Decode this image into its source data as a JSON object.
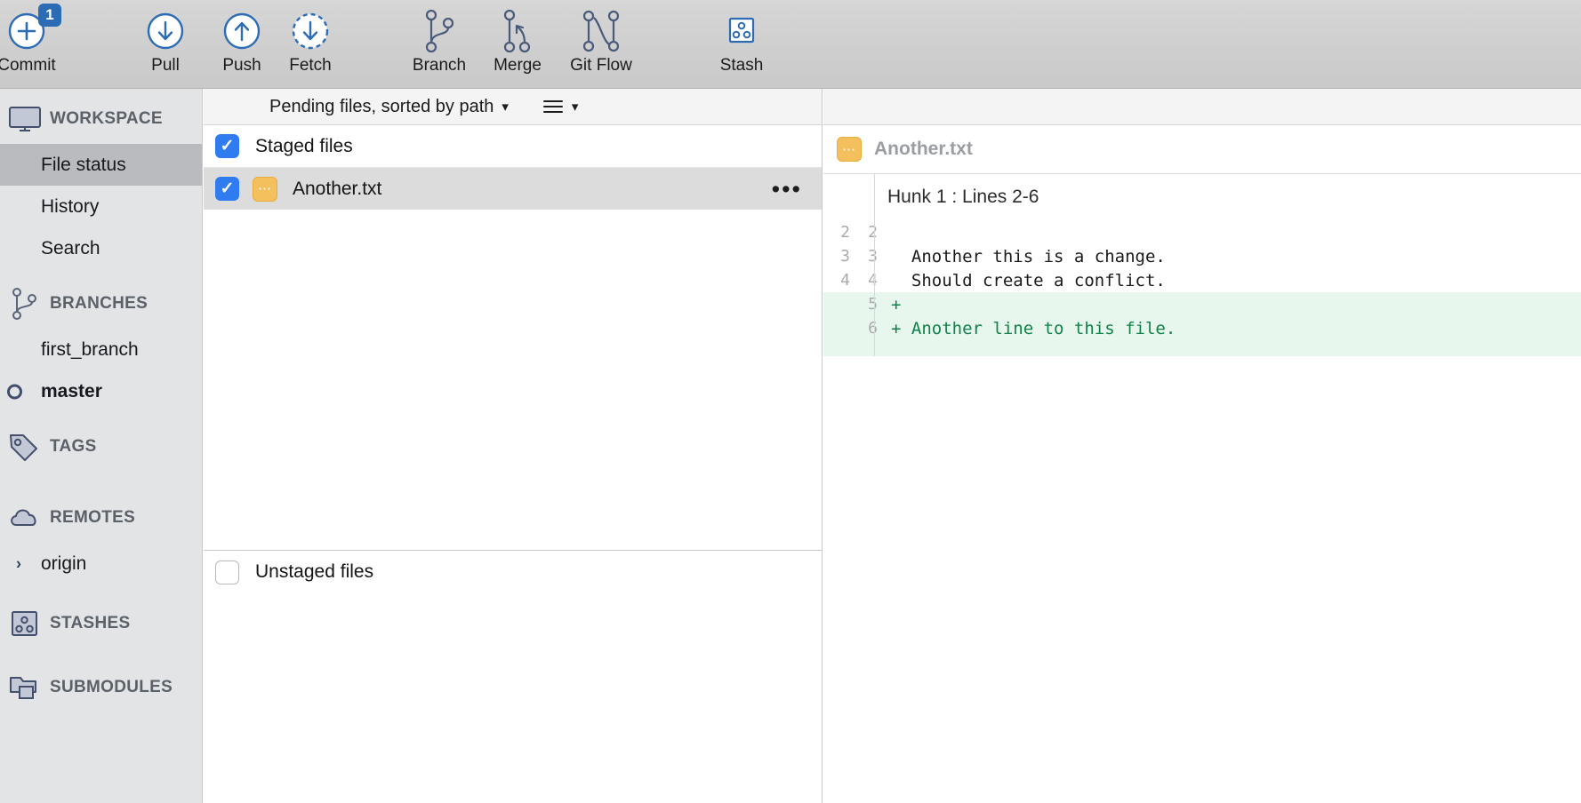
{
  "toolbar": {
    "items": [
      {
        "label": "Commit",
        "icon": "commit-plus-circle-icon",
        "badge": "1"
      },
      {
        "label": "Pull",
        "icon": "arrow-down-circle-icon",
        "badge": ""
      },
      {
        "label": "Push",
        "icon": "arrow-up-circle-icon",
        "badge": ""
      },
      {
        "label": "Fetch",
        "icon": "arrow-down-dashed-circle-icon",
        "badge": ""
      },
      {
        "label": "Branch",
        "icon": "branch-icon",
        "badge": ""
      },
      {
        "label": "Merge",
        "icon": "merge-icon",
        "badge": ""
      },
      {
        "label": "Git Flow",
        "icon": "git-flow-icon",
        "badge": ""
      },
      {
        "label": "Stash",
        "icon": "stash-icon",
        "badge": ""
      }
    ],
    "accent_color": "#2b6cb5",
    "badge_bg": "#2b6cb5"
  },
  "sidebar": {
    "sections": [
      {
        "title": "WORKSPACE",
        "icon": "monitor-icon"
      },
      {
        "title": "BRANCHES",
        "icon": "branch-icon"
      },
      {
        "title": "TAGS",
        "icon": "tag-icon"
      },
      {
        "title": "REMOTES",
        "icon": "cloud-icon"
      },
      {
        "title": "STASHES",
        "icon": "stash-icon"
      },
      {
        "title": "SUBMODULES",
        "icon": "submodule-icon"
      }
    ],
    "workspace_items": [
      {
        "label": "File status",
        "selected": true
      },
      {
        "label": "History",
        "selected": false
      },
      {
        "label": "Search",
        "selected": false
      }
    ],
    "branches": [
      {
        "label": "first_branch",
        "current": false
      },
      {
        "label": "master",
        "current": true
      }
    ],
    "remotes": [
      {
        "label": "origin",
        "expanded": false
      }
    ],
    "selected_color": "#b9bbbe"
  },
  "center": {
    "sort_label": "Pending files, sorted by path",
    "view_icon": "list-view-icon",
    "staged": {
      "group_label": "Staged files",
      "checked": true,
      "files": [
        {
          "name": "Another.txt",
          "checked": true,
          "status": "modified",
          "status_icon": "modified-dots-icon",
          "selected": true,
          "menu": "…"
        }
      ]
    },
    "unstaged": {
      "group_label": "Unstaged files",
      "checked": false,
      "files": []
    }
  },
  "diff": {
    "file_name": "Another.txt",
    "file_status_icon": "modified-dots-icon",
    "hunk_title": "Hunk 1 : Lines 2-6",
    "lines": [
      {
        "old": "2",
        "new": "2",
        "marker": "",
        "text": "",
        "type": "ctx"
      },
      {
        "old": "3",
        "new": "3",
        "marker": "",
        "text": "  Another this is a change.",
        "type": "ctx"
      },
      {
        "old": "4",
        "new": "4",
        "marker": "",
        "text": "  Should create a conflict.",
        "type": "ctx"
      },
      {
        "old": "",
        "new": "5",
        "marker": "+",
        "text": "+",
        "type": "add"
      },
      {
        "old": "",
        "new": "6",
        "marker": "+",
        "text": "+ Another line to this file.",
        "type": "add"
      }
    ],
    "add_bg": "#e8f7ed",
    "add_fg": "#11824a"
  }
}
